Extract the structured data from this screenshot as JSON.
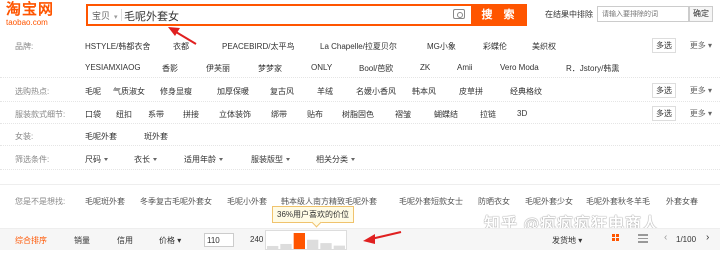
{
  "logo": {
    "brand": "淘宝网",
    "domain": "taobao.com"
  },
  "search": {
    "type_label": "宝贝",
    "query": "毛呢外套女",
    "button": "搜 索"
  },
  "in_result": {
    "label": "在结果中排除",
    "placeholder": "请输入要排除的词",
    "button": "确定"
  },
  "brand_row": {
    "key": "品牌:",
    "line1": [
      "HSTYLE/韩都衣舍",
      "衣都",
      "PEACEBIRD/太平鸟",
      "La Chapelle/拉夏贝尔",
      "MG小象",
      "彩蝶伦",
      "美织权"
    ],
    "line2": [
      "YESIAMXIAOG",
      "香影",
      "伊芙丽",
      "梦梦家",
      "ONLY",
      "Bool/芭欧",
      "ZK",
      "Amii",
      "Vero Moda",
      "R．Jstory/韩熏"
    ],
    "multi": "多选",
    "more": "更多"
  },
  "hot_row": {
    "key": "选购热点:",
    "items": [
      "毛呢",
      "气质淑女",
      "修身显瘦",
      "加厚保暖",
      "复古风",
      "羊绒",
      "名媛小香风",
      "韩本风",
      "皮草拼",
      "经典格纹"
    ],
    "multi": "多选",
    "more": "更多"
  },
  "detail_row": {
    "key": "服装款式细节:",
    "items": [
      "口袋",
      "纽扣",
      "系带",
      "拼接",
      "立体装饰",
      "绑带",
      "贴布",
      "树脂固色",
      "褶皱",
      "蝴蝶结",
      "拉链",
      "3D"
    ],
    "multi": "多选",
    "more": "更多"
  },
  "women_row": {
    "key": "女装:",
    "items": [
      "毛呢外套",
      "斑外套"
    ]
  },
  "criteria_row": {
    "key": "筛选条件:",
    "dropdowns": [
      "尺码",
      "衣长",
      "适用年龄",
      "服装版型",
      "相关分类"
    ]
  },
  "suggest_row": {
    "key": "您是不是想找:",
    "items": [
      "毛呢斑外套",
      "冬季复古毛呢外套女",
      "毛呢小外套",
      "韩本级人南方精致毛呢外套",
      "毛呢外套短款女士",
      "防晒衣女",
      "毛呢外套少女",
      "毛呢外套秋冬羊毛",
      "外套女春"
    ]
  },
  "sort_bar": {
    "items": [
      "综合排序",
      "销量",
      "信用"
    ],
    "price_label": "价格",
    "price_min": "110",
    "price_max": "240",
    "ship_from": "发货地",
    "page": "1/100"
  },
  "tooltip": "36%用户喜欢的价位",
  "price_distribution": [
    18,
    30,
    95,
    55,
    35,
    20
  ],
  "watermark": "知乎 @疯疯疯狂电商人",
  "colors": {
    "accent": "#ff5500",
    "arrow": "#e02020"
  }
}
